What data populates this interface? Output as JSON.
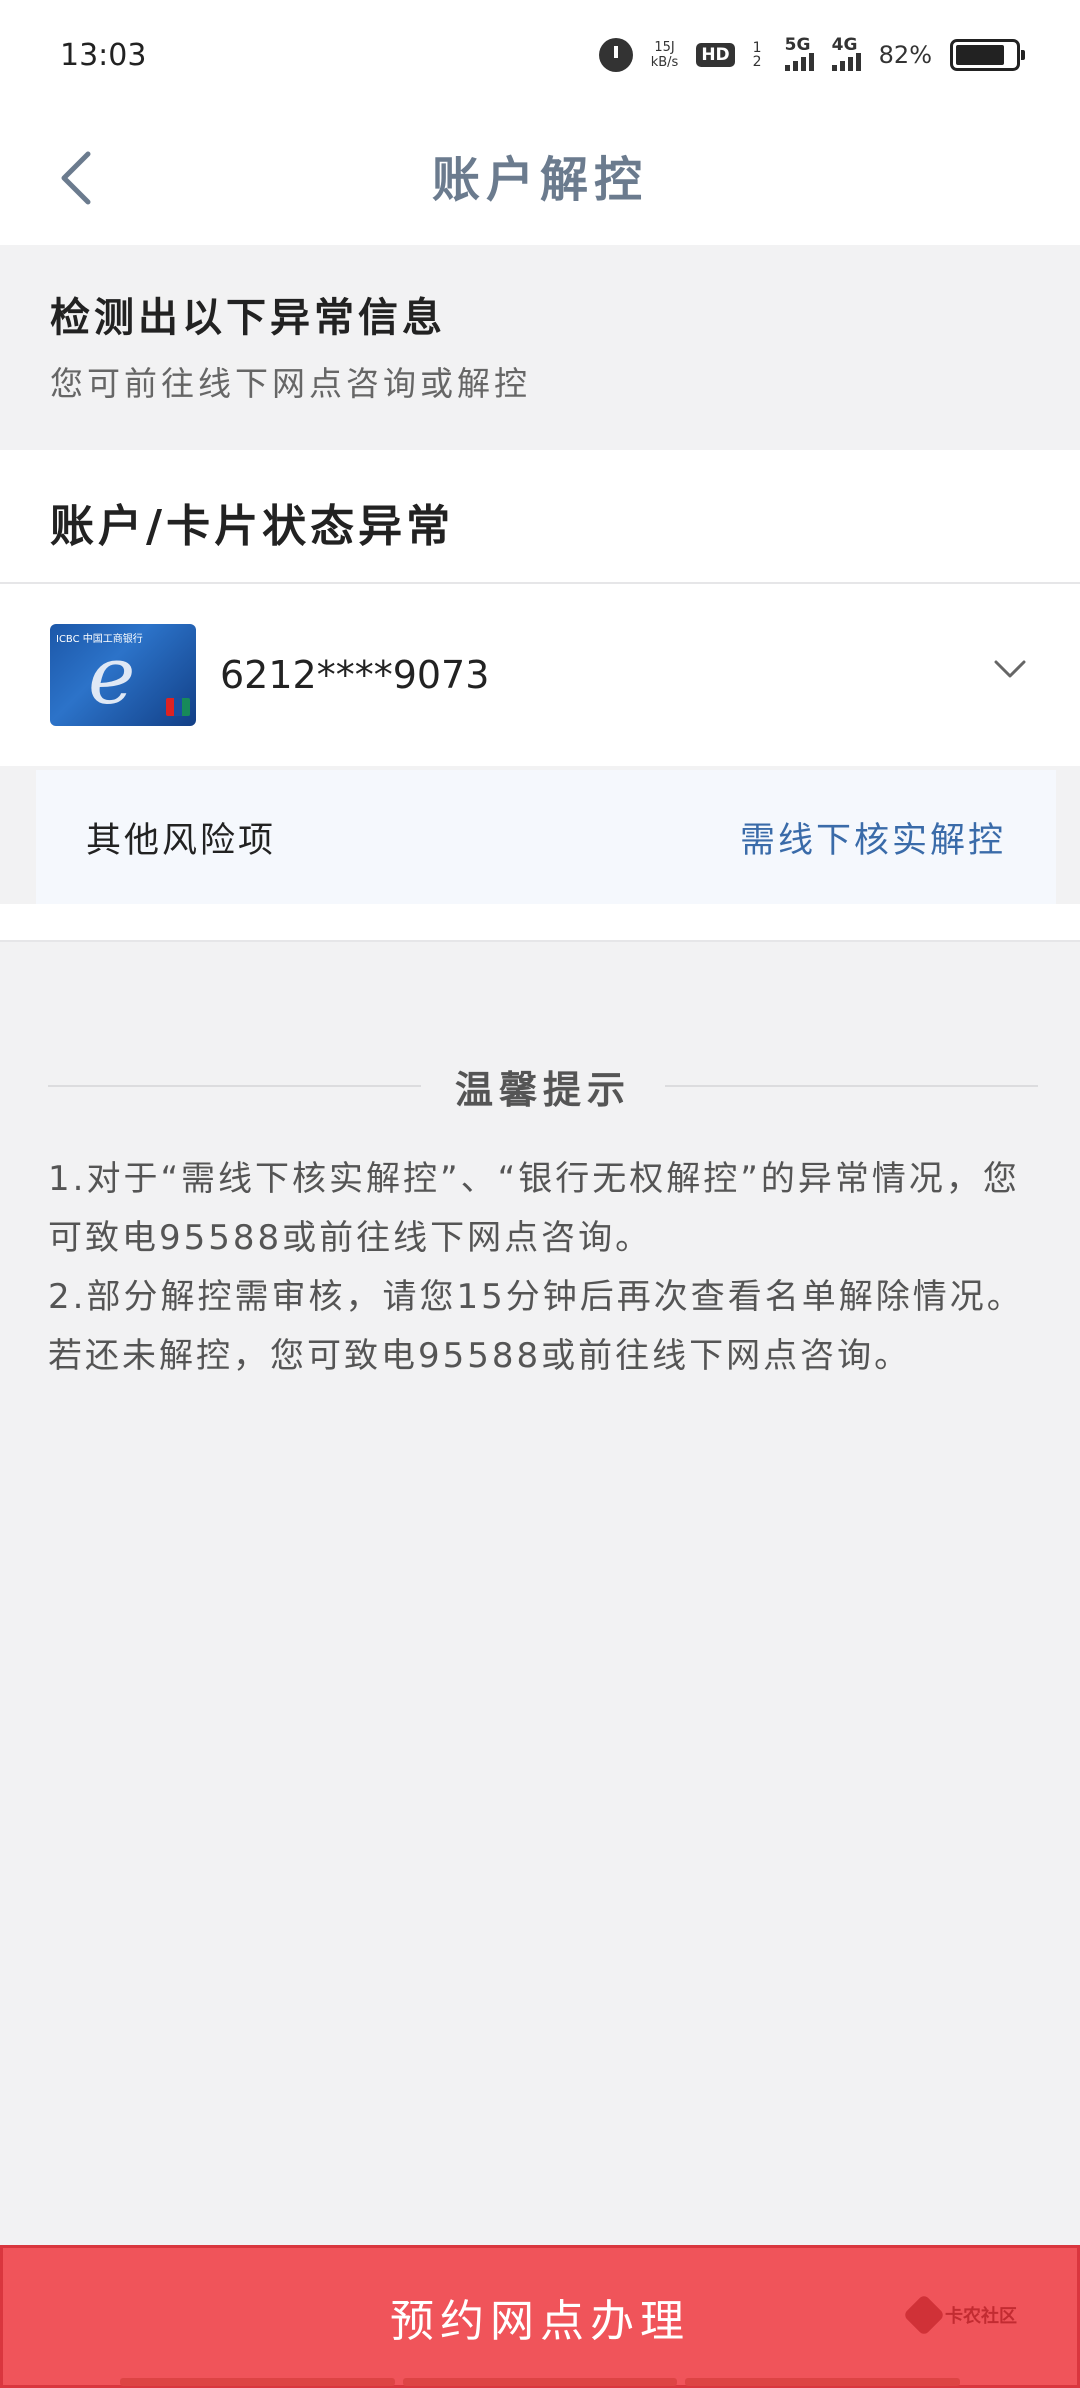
{
  "status_bar": {
    "time": "13:03",
    "net_speed_value": "15J",
    "net_speed_unit": "kB/s",
    "hd_label": "HD",
    "sim_index": "1 2",
    "signal_5g": "5G",
    "signal_4g": "4G",
    "battery": "82%",
    "battery_level": 0.82
  },
  "nav": {
    "title": "账户解控",
    "back_icon": "chevron-left-icon"
  },
  "notice": {
    "title": "检测出以下异常信息",
    "subtitle": "您可前往线下网点咨询或解控"
  },
  "account_status": {
    "heading": "账户/卡片状态异常",
    "card": {
      "brand_text": "ICBC 中国工商银行",
      "number": "6212****9073",
      "expand_icon": "chevron-down-icon"
    },
    "risk": {
      "label": "其他风险项",
      "action": "需线下核实解控"
    }
  },
  "tips": {
    "title": "温馨提示",
    "line1": "1.对于“需线下核实解控”、“银行无权解控”的异常情况，您可致电95588或前往线下网点咨询。",
    "line2": "2.部分解控需审核，请您15分钟后再次查看名单解除情况。若还未解控，您可致电95588或前往线下网点咨询。"
  },
  "bottom": {
    "button_label": "预约网点办理",
    "watermark_text": "卡农社区"
  },
  "colors": {
    "accent_link": "#3a6ba9",
    "button_bg": "#f0545a",
    "title_gray": "#6b7b8e"
  }
}
